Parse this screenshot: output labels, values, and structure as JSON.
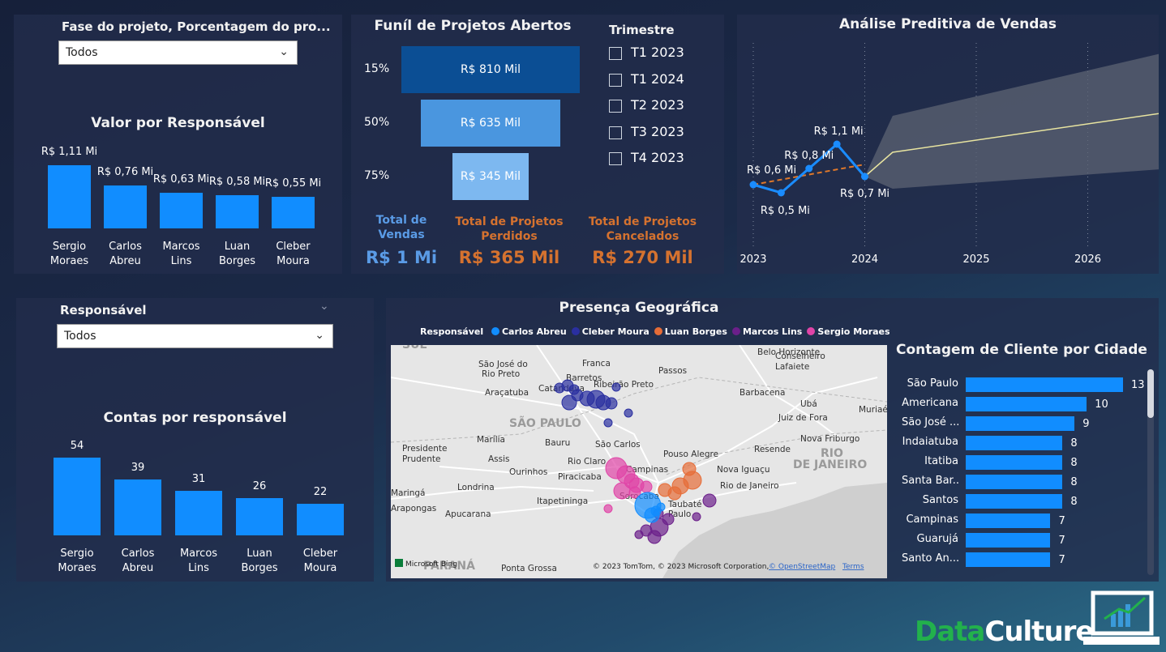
{
  "filters": {
    "fase": {
      "label": "Fase do projeto, Porcentagem do pro...",
      "value": "Todos"
    },
    "responsavel": {
      "label": "Responsável",
      "value": "Todos"
    }
  },
  "valor_chart": {
    "title": "Valor por Responsável",
    "categories": [
      "Sergio Moraes",
      "Carlos Abreu",
      "Marcos Lins",
      "Luan Borges",
      "Cleber Moura"
    ],
    "cat_lines": [
      [
        "Sergio",
        "Moraes"
      ],
      [
        "Carlos",
        "Abreu"
      ],
      [
        "Marcos",
        "Lins"
      ],
      [
        "Luan",
        "Borges"
      ],
      [
        "Cleber",
        "Moura"
      ]
    ],
    "values": [
      1.11,
      0.76,
      0.63,
      0.58,
      0.55
    ],
    "labels": [
      "R$ 1,11 Mi",
      "R$ 0,76 Mi",
      "R$ 0,63 Mi",
      "R$ 0,58 Mi",
      "R$ 0,55 Mi"
    ]
  },
  "funnel": {
    "title": "Funíl de Projetos Abertos",
    "stages": [
      {
        "pct": "15%",
        "value": 810,
        "label": "R$ 810 Mil",
        "color": "#0b4e94"
      },
      {
        "pct": "50%",
        "value": 635,
        "label": "R$ 635 Mil",
        "color": "#4a96df"
      },
      {
        "pct": "75%",
        "value": 345,
        "label": "R$ 345 Mil",
        "color": "#7db8f0"
      }
    ]
  },
  "trimestre": {
    "title": "Trimestre",
    "options": [
      "T1 2023",
      "T1 2024",
      "T2 2023",
      "T3 2023",
      "T4 2023"
    ]
  },
  "kpis": [
    {
      "label": "Total de Vendas",
      "l1": "Total de",
      "l2": "Vendas",
      "value": "R$ 1 Mi",
      "color": "#5a9be6"
    },
    {
      "label": "Total de Projetos Perdidos",
      "l1": "Total de Projetos",
      "l2": "Perdidos",
      "value": "R$ 365 Mil",
      "color": "#d5722f"
    },
    {
      "label": "Total de Projetos Cancelados",
      "l1": "Total de Projetos",
      "l2": "Cancelados",
      "value": "R$ 270 Mil",
      "color": "#d5722f"
    }
  ],
  "forecast_chart": {
    "title": "Análise Preditiva de Vendas",
    "x_ticks": [
      "2023",
      "2024",
      "2025",
      "2026"
    ],
    "actual": [
      {
        "x": "2023-01",
        "y": 0.6,
        "label": "R$ 0,6 Mi"
      },
      {
        "x": "2023-04",
        "y": 0.5,
        "label": "R$ 0,5 Mi"
      },
      {
        "x": "2023-07",
        "y": 0.8,
        "label": "R$ 0,8 Mi"
      },
      {
        "x": "2023-10",
        "y": 1.1,
        "label": "R$ 1,1 Mi"
      },
      {
        "x": "2024-01",
        "y": 0.7,
        "label": "R$ 0,7 Mi"
      }
    ],
    "trend": [
      {
        "x": "2023-01",
        "y": 0.6
      },
      {
        "x": "2024-01",
        "y": 0.85
      }
    ],
    "forecast": [
      {
        "x": "2024-01",
        "y": 0.7
      },
      {
        "x": "2024-04",
        "y": 1.0
      },
      {
        "x": "2026-10",
        "y": 1.5
      }
    ],
    "band_upper": [
      {
        "x": "2024-01",
        "y": 0.7
      },
      {
        "x": "2024-04",
        "y": 1.45
      },
      {
        "x": "2026-10",
        "y": 2.25
      }
    ],
    "band_lower": [
      {
        "x": "2024-01",
        "y": 0.7
      },
      {
        "x": "2024-04",
        "y": 0.55
      },
      {
        "x": "2026-10",
        "y": 0.8
      }
    ],
    "colors": {
      "actual": "#1a8cff",
      "trend": "#e0782a",
      "forecast": "#e8e4a0",
      "band": "#5c6373"
    }
  },
  "contas_chart": {
    "title": "Contas por responsável",
    "categories": [
      "Sergio Moraes",
      "Carlos Abreu",
      "Marcos Lins",
      "Luan Borges",
      "Cleber Moura"
    ],
    "cat_lines": [
      [
        "Sergio",
        "Moraes"
      ],
      [
        "Carlos",
        "Abreu"
      ],
      [
        "Marcos",
        "Lins"
      ],
      [
        "Luan",
        "Borges"
      ],
      [
        "Cleber",
        "Moura"
      ]
    ],
    "values": [
      54,
      39,
      31,
      26,
      22
    ]
  },
  "map": {
    "title": "Presença Geográfica",
    "legend_title": "Responsável",
    "legend": [
      {
        "name": "Carlos Abreu",
        "color": "#118dff"
      },
      {
        "name": "Cleber Moura",
        "color": "#2a2fa0"
      },
      {
        "name": "Luan Borges",
        "color": "#e66c37"
      },
      {
        "name": "Marcos Lins",
        "color": "#6b1f8a"
      },
      {
        "name": "Sergio Moraes",
        "color": "#e044a7"
      }
    ],
    "place_labels": [
      "São José do",
      "Rio Preto",
      "Franca",
      "Barretos",
      "Passos",
      "Belo Horizonte",
      "Conselheiro",
      "Lafaiete",
      "Catanduva",
      "Araçatuba",
      "Ribeirão Preto",
      "Barbacena",
      "Ubá",
      "Juiz de Fora",
      "Muriaé",
      "SÃO PAULO",
      "Marília",
      "Bauru",
      "São Carlos",
      "Pouso Alegre",
      "Nova Friburgo",
      "Resende",
      "RIO",
      "DE JANEIRO",
      "Presidente",
      "Prudente",
      "Assis",
      "Ourinhos",
      "Rio Claro",
      "Piracicaba",
      "Campinas",
      "Nova Iguaçu",
      "Rio de Janeiro",
      "Londrina",
      "Itapetininga",
      "Maringá",
      "Apucarana",
      "Arapongas",
      "Taubaté",
      "Sorocaba",
      "Paulo",
      "Ponta Grossa",
      "PARANÁ",
      "SUL"
    ],
    "attribution": "© 2023 TomTom, © 2023 Microsoft Corporation, ",
    "osm": "© OpenStreetMap",
    "terms": "Terms",
    "bing": "Microsoft Bing"
  },
  "city_chart": {
    "title": "Contagem de Cliente por Cidade",
    "cities": [
      "São Paulo",
      "Americana",
      "São José ...",
      "Indaiatuba",
      "Itatiba",
      "Santa Bar...",
      "Santos",
      "Campinas",
      "Guarujá",
      "Santo An..."
    ],
    "values": [
      13,
      10,
      9,
      8,
      8,
      8,
      8,
      7,
      7,
      7
    ]
  },
  "brand": {
    "data": "Data",
    "culture": "Culture",
    "green": "#22b14c"
  }
}
